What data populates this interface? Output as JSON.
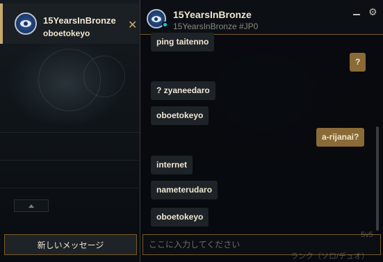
{
  "left_panel": {
    "conversation": {
      "name": "15YearsInBronze",
      "preview": "oboetokeyo",
      "close_glyph": "✕",
      "avatar_icon": "eye-icon"
    },
    "collapse_icon": "chevron-up-icon",
    "new_message_label": "新しいメッセージ"
  },
  "chat": {
    "header": {
      "name": "15YearsInBronze",
      "tag": "15YearsInBronze #JP0",
      "gear_glyph": "⚙",
      "status": "online"
    },
    "messages": [
      {
        "direction": "in",
        "text": "ping taitenno"
      },
      {
        "direction": "out",
        "text": "?"
      },
      {
        "direction": "in",
        "text": "? zyaneedaro"
      },
      {
        "direction": "in",
        "text": "oboetokeyo"
      },
      {
        "direction": "out",
        "text": "a-rijanai?"
      },
      {
        "direction": "in",
        "text": "internet"
      },
      {
        "direction": "in",
        "text": "nameterudaro"
      },
      {
        "direction": "in",
        "text": "oboetokeyo"
      }
    ],
    "input": {
      "value": "",
      "placeholder": "ここに入力してください"
    }
  },
  "background": {
    "mode_text": "5v5",
    "ranked_text": "ランク（ソロ/デュオ）"
  },
  "colors": {
    "gold": "#c8aa6e",
    "gold_dark": "#785a28",
    "outgoing_bubble": "#8a6a36",
    "incoming_bubble": "#1e2328",
    "status_online": "#0acbe6"
  }
}
